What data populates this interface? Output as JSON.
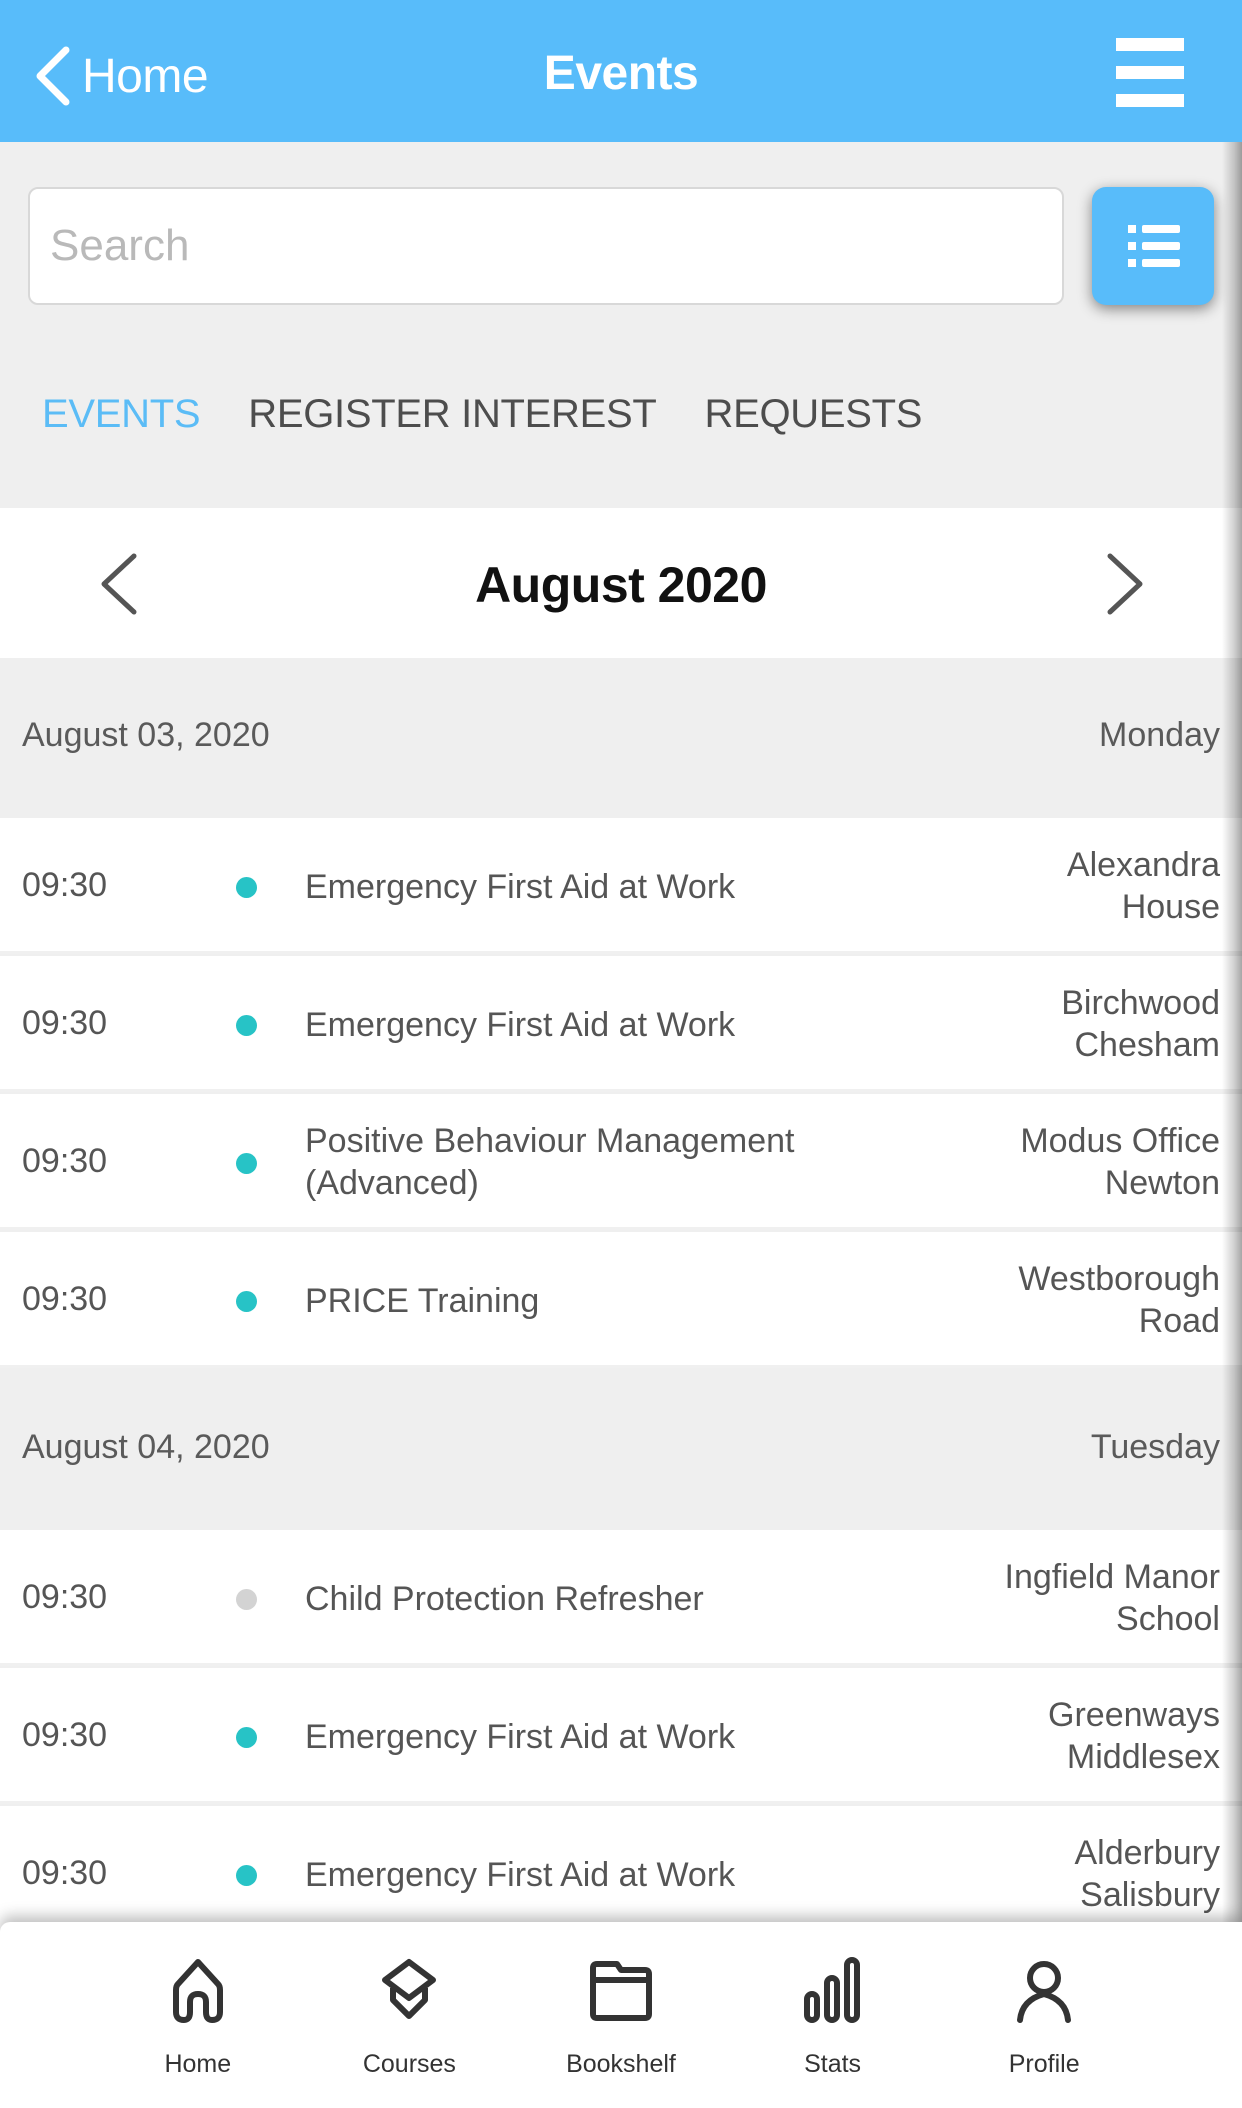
{
  "header": {
    "back_label": "Home",
    "title": "Events",
    "menu_icon": "hamburger-menu-icon"
  },
  "search": {
    "placeholder": "Search",
    "value": "",
    "list_view_icon": "list-icon"
  },
  "tabs": [
    {
      "label": "EVENTS",
      "active": true
    },
    {
      "label": "REGISTER INTEREST",
      "active": false
    },
    {
      "label": "REQUESTS",
      "active": false
    }
  ],
  "month_nav": {
    "title": "August 2020",
    "prev_icon": "chevron-left-icon",
    "next_icon": "chevron-right-icon"
  },
  "colors": {
    "brand": "#58bcfa",
    "active_tab": "#5bbcf6",
    "status_available": "#27c3c6",
    "status_unavailable": "#d3d3d3"
  },
  "days": [
    {
      "date": "August 03, 2020",
      "weekday": "Monday",
      "events": [
        {
          "time": "09:30",
          "status": "available",
          "title": "Emergency First Aid at Work",
          "location": [
            "Alexandra",
            "House"
          ]
        },
        {
          "time": "09:30",
          "status": "available",
          "title": "Emergency First Aid at Work",
          "location": [
            "Birchwood",
            "Chesham"
          ]
        },
        {
          "time": "09:30",
          "status": "available",
          "title": [
            "Positive Behaviour Management",
            "(Advanced)"
          ],
          "location": [
            "Modus Office",
            "Newton"
          ]
        },
        {
          "time": "09:30",
          "status": "available",
          "title": "PRICE Training",
          "location": [
            "Westborough",
            "Road"
          ]
        }
      ]
    },
    {
      "date": "August 04, 2020",
      "weekday": "Tuesday",
      "events": [
        {
          "time": "09:30",
          "status": "unavailable",
          "title": "Child Protection Refresher",
          "location": [
            "Ingfield Manor",
            "School"
          ]
        },
        {
          "time": "09:30",
          "status": "available",
          "title": "Emergency First Aid at Work",
          "location": [
            "Greenways",
            "Middlesex"
          ]
        },
        {
          "time": "09:30",
          "status": "available",
          "title": "Emergency First Aid at Work",
          "location": [
            "Alderbury",
            "Salisbury"
          ]
        }
      ]
    }
  ],
  "bottom_nav": [
    {
      "label": "Home",
      "icon": "home-icon"
    },
    {
      "label": "Courses",
      "icon": "graduation-cap-icon"
    },
    {
      "label": "Bookshelf",
      "icon": "folder-icon"
    },
    {
      "label": "Stats",
      "icon": "bar-chart-icon"
    },
    {
      "label": "Profile",
      "icon": "user-icon"
    }
  ]
}
